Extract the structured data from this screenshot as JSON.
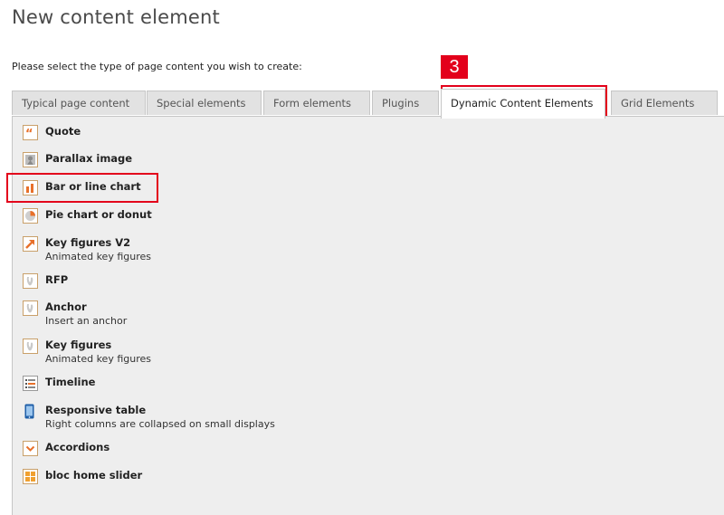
{
  "page": {
    "title": "New content element",
    "instruction": "Please select the type of page content you wish to create:",
    "callout_number": "3"
  },
  "tabs": [
    {
      "label": "Typical page content",
      "active": false
    },
    {
      "label": "Special elements",
      "active": false
    },
    {
      "label": "Form elements",
      "active": false
    },
    {
      "label": "Plugins",
      "active": false
    },
    {
      "label": "Dynamic Content Elements",
      "active": true
    },
    {
      "label": "Grid Elements",
      "active": false
    }
  ],
  "items": [
    {
      "title": "Quote",
      "description": "",
      "icon": "quote-icon"
    },
    {
      "title": "Parallax image",
      "description": "",
      "icon": "parallax-image-icon"
    },
    {
      "title": "Bar or line chart",
      "description": "",
      "icon": "bar-chart-icon"
    },
    {
      "title": "Pie chart or donut",
      "description": "",
      "icon": "pie-chart-icon"
    },
    {
      "title": "Key figures V2",
      "description": "Animated key figures",
      "icon": "arrow-up-right-icon"
    },
    {
      "title": "RFP",
      "description": "",
      "icon": "typo3-logo-icon"
    },
    {
      "title": "Anchor",
      "description": "Insert an anchor",
      "icon": "typo3-logo-icon"
    },
    {
      "title": "Key figures",
      "description": "Animated key figures",
      "icon": "typo3-logo-icon"
    },
    {
      "title": "Timeline",
      "description": "",
      "icon": "timeline-list-icon"
    },
    {
      "title": "Responsive table",
      "description": "Right columns are collapsed on small displays",
      "icon": "mobile-phone-icon"
    },
    {
      "title": "Accordions",
      "description": "",
      "icon": "chevron-down-icon"
    },
    {
      "title": "bloc home slider",
      "description": "",
      "icon": "slider-grid-icon"
    }
  ],
  "colors": {
    "accent_orange": "#e8702a",
    "highlight_red": "#e3001b",
    "panel_bg": "#eeeeee",
    "tab_bg": "#e2e2e2"
  }
}
